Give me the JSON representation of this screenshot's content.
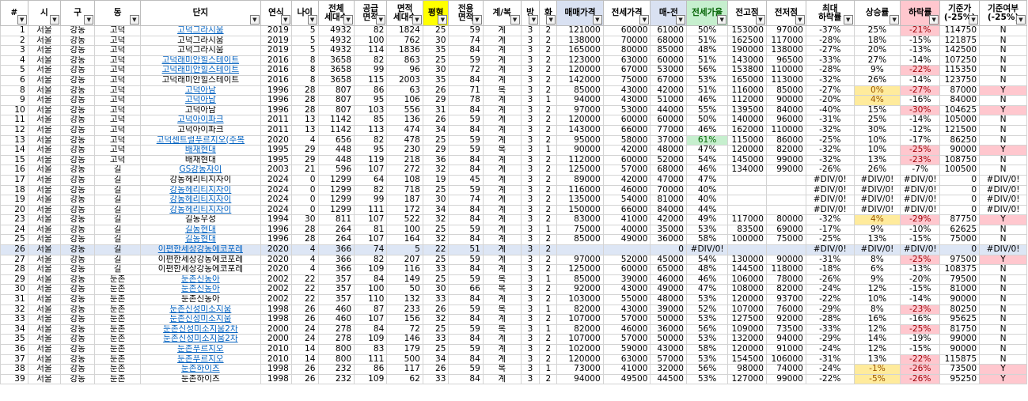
{
  "headers": [
    {
      "label": "#",
      "cls": ""
    },
    {
      "label": "시",
      "cls": ""
    },
    {
      "label": "구",
      "cls": ""
    },
    {
      "label": "동",
      "cls": ""
    },
    {
      "label": "단지",
      "cls": ""
    },
    {
      "label": "연식",
      "cls": ""
    },
    {
      "label": "나이",
      "cls": ""
    },
    {
      "label": "전체\n세대수",
      "cls": ""
    },
    {
      "label": "공급\n면적",
      "cls": ""
    },
    {
      "label": "면적\n세대수",
      "cls": ""
    },
    {
      "label": "평형",
      "cls": "yel"
    },
    {
      "label": "전용\n면적",
      "cls": ""
    },
    {
      "label": "계/복",
      "cls": ""
    },
    {
      "label": "방",
      "cls": ""
    },
    {
      "label": "화",
      "cls": ""
    },
    {
      "label": "매매가격",
      "cls": "blu"
    },
    {
      "label": "전세가격",
      "cls": ""
    },
    {
      "label": "매-전",
      "cls": "blu"
    },
    {
      "label": "전세가율",
      "cls": "grn"
    },
    {
      "label": "전고점",
      "cls": ""
    },
    {
      "label": "전저점",
      "cls": ""
    },
    {
      "label": "최대\n하락률",
      "cls": ""
    },
    {
      "label": "상승률",
      "cls": ""
    },
    {
      "label": "하락률",
      "cls": "pnk"
    },
    {
      "label": "기준가\n(-25%)",
      "cls": ""
    },
    {
      "label": "기준여부\n(-25%)",
      "cls": ""
    }
  ],
  "colors": {
    "yellow_fill": "#ffeb9c",
    "pink_fill": "#ffc7ce",
    "green_fill": "#c6efce",
    "selected_row": "#dde6f5",
    "link": "#0563c1"
  },
  "rows": [
    [
      "1",
      "서울",
      "강동",
      "고덕",
      "고덕그라시움",
      "2019",
      "5",
      "4932",
      "82",
      "1824",
      "25",
      "59",
      "계",
      "3",
      "2",
      "121000",
      "60000",
      "61000",
      "50%",
      "153000",
      "97000",
      "-37%",
      "25%",
      "-21%",
      "114750",
      "N"
    ],
    [
      "2",
      "서울",
      "강동",
      "고덕",
      "고덕그라시움",
      "2019",
      "5",
      "4932",
      "100",
      "762",
      "30",
      "74",
      "계",
      "3",
      "2",
      "138000",
      "70000",
      "68000",
      "51%",
      "162500",
      "117000",
      "-28%",
      "18%",
      "-15%",
      "121875",
      "N"
    ],
    [
      "3",
      "서울",
      "강동",
      "고덕",
      "고덕그라시움",
      "2019",
      "5",
      "4932",
      "114",
      "1836",
      "35",
      "84",
      "계",
      "3",
      "2",
      "165000",
      "80000",
      "85000",
      "48%",
      "190000",
      "138000",
      "-27%",
      "20%",
      "-13%",
      "142500",
      "N"
    ],
    [
      "4",
      "서울",
      "강동",
      "고덕",
      "고덕래미안힐스테이트",
      "2016",
      "8",
      "3658",
      "82",
      "863",
      "25",
      "59",
      "계",
      "3",
      "2",
      "123000",
      "63000",
      "60000",
      "51%",
      "143000",
      "96500",
      "-33%",
      "27%",
      "-14%",
      "107250",
      "N"
    ],
    [
      "5",
      "서울",
      "강동",
      "고덕",
      "고덕래미안힐스테이트",
      "2016",
      "8",
      "3658",
      "99",
      "96",
      "30",
      "72",
      "계",
      "3",
      "2",
      "120000",
      "67000",
      "53000",
      "56%",
      "153800",
      "110000",
      "-28%",
      "9%",
      "-22%",
      "115350",
      "N"
    ],
    [
      "6",
      "서울",
      "강동",
      "고덕",
      "고덕래미안힐스테이트",
      "2016",
      "8",
      "3658",
      "115",
      "2003",
      "35",
      "84",
      "계",
      "3",
      "2",
      "142000",
      "75000",
      "67000",
      "53%",
      "165000",
      "113000",
      "-32%",
      "26%",
      "-14%",
      "123750",
      "N"
    ],
    [
      "8",
      "서울",
      "강동",
      "고덕",
      "고덕아남",
      "1996",
      "28",
      "807",
      "86",
      "63",
      "26",
      "71",
      "복",
      "3",
      "2",
      "85000",
      "43000",
      "42000",
      "51%",
      "116000",
      "85000",
      "-27%",
      "0%",
      "-27%",
      "87000",
      "Y"
    ],
    [
      "9",
      "서울",
      "강동",
      "고덕",
      "고덕아남",
      "1996",
      "28",
      "807",
      "95",
      "106",
      "29",
      "78",
      "계",
      "3",
      "1",
      "94000",
      "43000",
      "51000",
      "46%",
      "112000",
      "90000",
      "-20%",
      "4%",
      "-16%",
      "84000",
      "N"
    ],
    [
      "10",
      "서울",
      "강동",
      "고덕",
      "고덕아남",
      "1996",
      "28",
      "807",
      "103",
      "556",
      "31",
      "84",
      "계",
      "3",
      "2",
      "97000",
      "53000",
      "44000",
      "55%",
      "139500",
      "84000",
      "-40%",
      "15%",
      "-30%",
      "104625",
      "Y"
    ],
    [
      "11",
      "서울",
      "강동",
      "고덕",
      "고덕아이파크",
      "2011",
      "13",
      "1142",
      "85",
      "136",
      "26",
      "59",
      "계",
      "3",
      "2",
      "120000",
      "60000",
      "60000",
      "50%",
      "140000",
      "96000",
      "-31%",
      "25%",
      "-14%",
      "105000",
      "N"
    ],
    [
      "12",
      "서울",
      "강동",
      "고덕",
      "고덕아이파크",
      "2011",
      "13",
      "1142",
      "113",
      "474",
      "34",
      "84",
      "계",
      "3",
      "2",
      "143000",
      "66000",
      "77000",
      "46%",
      "162000",
      "110000",
      "-32%",
      "30%",
      "-12%",
      "121500",
      "N"
    ],
    [
      "13",
      "서울",
      "강동",
      "고덕",
      "고덕센트럴푸르지오(주복",
      "2020",
      "4",
      "656",
      "82",
      "478",
      "25",
      "59",
      "계",
      "3",
      "2",
      "95000",
      "58000",
      "37000",
      "61%",
      "115000",
      "86000",
      "-25%",
      "10%",
      "-17%",
      "86250",
      "N"
    ],
    [
      "14",
      "서울",
      "강동",
      "고덕",
      "배재현대",
      "1995",
      "29",
      "448",
      "95",
      "230",
      "29",
      "59",
      "복",
      "3",
      "1",
      "90000",
      "42000",
      "48000",
      "47%",
      "120000",
      "82000",
      "-32%",
      "10%",
      "-25%",
      "90000",
      "Y"
    ],
    [
      "15",
      "서울",
      "강동",
      "고덕",
      "배재현대",
      "1995",
      "29",
      "448",
      "119",
      "218",
      "36",
      "84",
      "계",
      "3",
      "2",
      "112000",
      "60000",
      "52000",
      "54%",
      "145000",
      "99000",
      "-32%",
      "13%",
      "-23%",
      "108750",
      "N"
    ],
    [
      "16",
      "서울",
      "강동",
      "길",
      "GS강동자이",
      "2003",
      "21",
      "596",
      "107",
      "272",
      "32",
      "84",
      "계",
      "3",
      "2",
      "125000",
      "57000",
      "68000",
      "46%",
      "134000",
      "99000",
      "-26%",
      "26%",
      "-7%",
      "100500",
      "N"
    ],
    [
      "17",
      "서울",
      "강동",
      "길",
      "강동헤리티지자이",
      "2024",
      "0",
      "1299",
      "64",
      "108",
      "19",
      "45",
      "계",
      "3",
      "2",
      "89000",
      "42000",
      "47000",
      "47%",
      "",
      "",
      "#DIV/0!",
      "#DIV/0!",
      "#DIV/0!",
      "0",
      "#DIV/0!"
    ],
    [
      "18",
      "서울",
      "강동",
      "길",
      "강동헤리티지자이",
      "2024",
      "0",
      "1299",
      "82",
      "718",
      "25",
      "59",
      "계",
      "3",
      "2",
      "116000",
      "46000",
      "70000",
      "40%",
      "",
      "",
      "#DIV/0!",
      "#DIV/0!",
      "#DIV/0!",
      "0",
      "#DIV/0!"
    ],
    [
      "19",
      "서울",
      "강동",
      "길",
      "강동헤리티지자이",
      "2024",
      "0",
      "1299",
      "99",
      "187",
      "30",
      "74",
      "계",
      "3",
      "2",
      "135000",
      "54000",
      "81000",
      "40%",
      "",
      "",
      "#DIV/0!",
      "#DIV/0!",
      "#DIV/0!",
      "0",
      "#DIV/0!"
    ],
    [
      "20",
      "서울",
      "강동",
      "길",
      "강동헤리티지자이",
      "2024",
      "0",
      "1299",
      "111",
      "172",
      "34",
      "84",
      "계",
      "3",
      "2",
      "150000",
      "66000",
      "84000",
      "44%",
      "",
      "",
      "#DIV/0!",
      "#DIV/0!",
      "#DIV/0!",
      "0",
      "#DIV/0!"
    ],
    [
      "23",
      "서울",
      "강동",
      "길",
      "길동우성",
      "1994",
      "30",
      "811",
      "107",
      "522",
      "32",
      "84",
      "계",
      "3",
      "2",
      "83000",
      "41000",
      "42000",
      "49%",
      "117000",
      "80000",
      "-32%",
      "4%",
      "-29%",
      "87750",
      "Y"
    ],
    [
      "24",
      "서울",
      "강동",
      "길",
      "길동현대",
      "1996",
      "28",
      "264",
      "81",
      "100",
      "25",
      "59",
      "계",
      "3",
      "1",
      "75000",
      "40000",
      "35000",
      "53%",
      "83500",
      "69000",
      "-17%",
      "9%",
      "-10%",
      "62625",
      "N"
    ],
    [
      "25",
      "서울",
      "강동",
      "길",
      "길동현대",
      "1996",
      "28",
      "264",
      "107",
      "164",
      "32",
      "84",
      "계",
      "3",
      "2",
      "85000",
      "49000",
      "36000",
      "58%",
      "100000",
      "75000",
      "-25%",
      "13%",
      "-15%",
      "75000",
      "N"
    ],
    [
      "26",
      "서울",
      "강동",
      "길",
      "이편한세상강동에코포레",
      "2020",
      "4",
      "366",
      "74",
      "5",
      "22",
      "51",
      "계",
      "3",
      "2",
      "",
      "",
      "0",
      "#DIV/0!",
      "",
      "",
      "#DIV/0!",
      "#DIV/0!",
      "#DIV/0!",
      "0",
      "#DIV/0!"
    ],
    [
      "27",
      "서울",
      "강동",
      "길",
      "이편한세상강동에코포레",
      "2020",
      "4",
      "366",
      "82",
      "207",
      "25",
      "59",
      "계",
      "3",
      "2",
      "97000",
      "52000",
      "45000",
      "54%",
      "130000",
      "90000",
      "-31%",
      "8%",
      "-25%",
      "97500",
      "Y"
    ],
    [
      "28",
      "서울",
      "강동",
      "길",
      "이편한세상강동에코포레",
      "2020",
      "4",
      "366",
      "109",
      "116",
      "33",
      "84",
      "계",
      "3",
      "2",
      "125000",
      "60000",
      "65000",
      "48%",
      "144500",
      "118000",
      "-18%",
      "6%",
      "-13%",
      "108375",
      "N"
    ],
    [
      "29",
      "서울",
      "강동",
      "둔촌",
      "둔촌신동아",
      "2002",
      "22",
      "357",
      "84",
      "149",
      "25",
      "59",
      "복",
      "3",
      "1",
      "85000",
      "39000",
      "46000",
      "46%",
      "106000",
      "78000",
      "-26%",
      "9%",
      "-20%",
      "79500",
      "N"
    ],
    [
      "30",
      "서울",
      "강동",
      "둔촌",
      "둔촌신동아",
      "2002",
      "22",
      "357",
      "100",
      "50",
      "30",
      "66",
      "복",
      "3",
      "2",
      "92000",
      "43000",
      "49000",
      "47%",
      "108000",
      "82000",
      "-24%",
      "12%",
      "-15%",
      "81000",
      "N"
    ],
    [
      "31",
      "서울",
      "강동",
      "둔촌",
      "둔촌신동아",
      "2002",
      "22",
      "357",
      "110",
      "132",
      "33",
      "84",
      "계",
      "3",
      "2",
      "103000",
      "55000",
      "48000",
      "53%",
      "120000",
      "93700",
      "-22%",
      "10%",
      "-14%",
      "90000",
      "N"
    ],
    [
      "32",
      "서울",
      "강동",
      "둔촌",
      "둔촌신성미소지움",
      "1998",
      "26",
      "460",
      "87",
      "233",
      "26",
      "59",
      "복",
      "3",
      "1",
      "82000",
      "43000",
      "39000",
      "52%",
      "107000",
      "76000",
      "-29%",
      "8%",
      "-23%",
      "80250",
      "N"
    ],
    [
      "33",
      "서울",
      "강동",
      "둔촌",
      "둔촌신성미소지움",
      "1998",
      "26",
      "460",
      "107",
      "156",
      "32",
      "84",
      "계",
      "3",
      "2",
      "107000",
      "57000",
      "50000",
      "53%",
      "127500",
      "92000",
      "-28%",
      "16%",
      "-16%",
      "95625",
      "N"
    ],
    [
      "34",
      "서울",
      "강동",
      "둔촌",
      "둔촌신성미소지움2차",
      "2000",
      "24",
      "278",
      "84",
      "72",
      "25",
      "59",
      "복",
      "3",
      "1",
      "82000",
      "46000",
      "36000",
      "56%",
      "109000",
      "73500",
      "-33%",
      "12%",
      "-25%",
      "81750",
      "N"
    ],
    [
      "35",
      "서울",
      "강동",
      "둔촌",
      "둔촌신성미소지움2차",
      "2000",
      "24",
      "278",
      "109",
      "146",
      "33",
      "84",
      "계",
      "3",
      "2",
      "107000",
      "57000",
      "50000",
      "53%",
      "132000",
      "94000",
      "-29%",
      "14%",
      "-19%",
      "99000",
      "N"
    ],
    [
      "36",
      "서울",
      "강동",
      "둔촌",
      "둔촌푸르지오",
      "2010",
      "14",
      "800",
      "83",
      "179",
      "25",
      "59",
      "계",
      "3",
      "2",
      "102000",
      "59000",
      "43000",
      "58%",
      "120000",
      "91000",
      "-24%",
      "12%",
      "-15%",
      "90000",
      "N"
    ],
    [
      "37",
      "서울",
      "강동",
      "둔촌",
      "둔촌푸르지오",
      "2010",
      "14",
      "800",
      "111",
      "500",
      "34",
      "84",
      "계",
      "3",
      "2",
      "120000",
      "63000",
      "57000",
      "53%",
      "154500",
      "106000",
      "-31%",
      "13%",
      "-22%",
      "115875",
      "N"
    ],
    [
      "38",
      "서울",
      "강동",
      "둔촌",
      "둔촌하이츠",
      "1998",
      "26",
      "232",
      "86",
      "117",
      "26",
      "59",
      "복",
      "3",
      "1",
      "73000",
      "41000",
      "32000",
      "56%",
      "98000",
      "74000",
      "-24%",
      "-1%",
      "-26%",
      "73500",
      "Y"
    ],
    [
      "39",
      "서울",
      "강동",
      "둔촌",
      "둔촌하이츠",
      "1998",
      "26",
      "232",
      "109",
      "62",
      "33",
      "84",
      "계",
      "3",
      "2",
      "94000",
      "49500",
      "44500",
      "53%",
      "127000",
      "99000",
      "-22%",
      "-5%",
      "-26%",
      "95250",
      "Y"
    ]
  ],
  "link_rows": [
    0,
    3,
    4,
    6,
    7,
    9,
    11,
    12,
    14,
    16,
    17,
    18,
    20,
    21,
    22,
    25,
    26,
    28,
    29,
    30,
    31,
    32,
    33,
    34
  ],
  "selected_row": 22
}
